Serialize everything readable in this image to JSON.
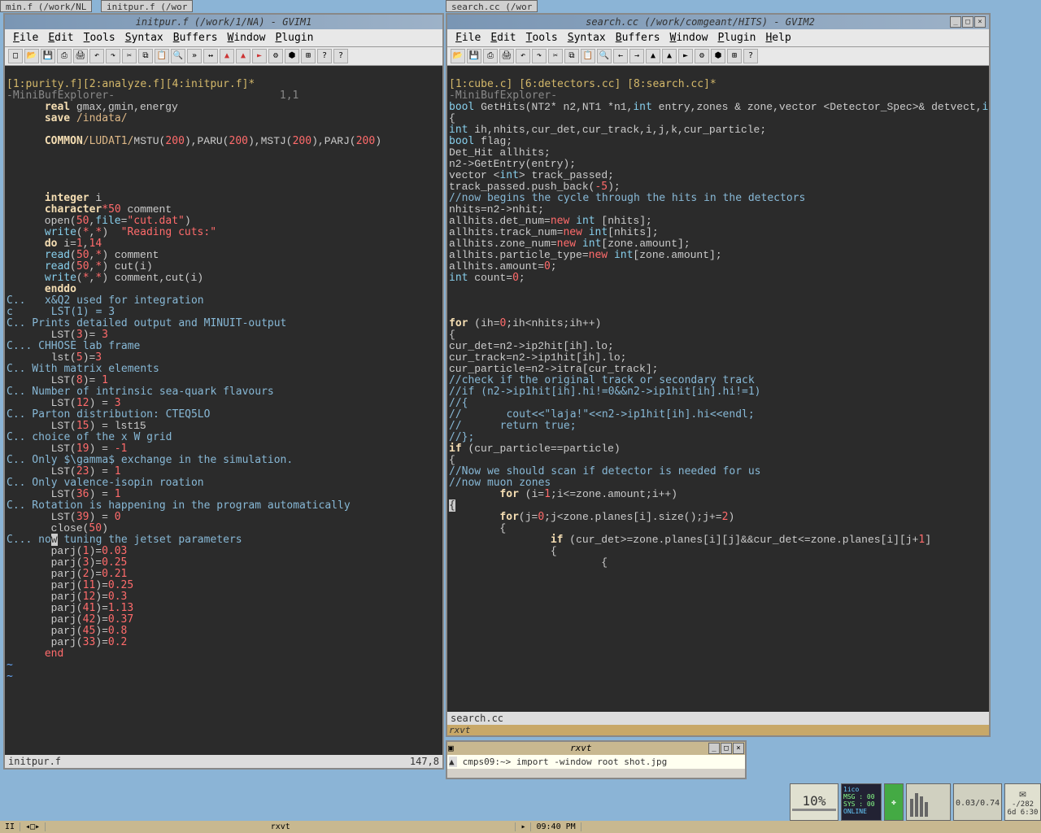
{
  "wmtabs": {
    "t1": "min.f  (/work/NL",
    "t2": "initpur.f  (/wor",
    "t3": "search.cc  (/wor"
  },
  "gvim1": {
    "title": "initpur.f (/work/1/NA) - GVIM1",
    "menus": [
      "File",
      "Edit",
      "Tools",
      "Syntax",
      "Buffers",
      "Window",
      "Plugin"
    ],
    "bufline": "[1:purity.f][2:analyze.f][4:initpur.f]*",
    "minibuf": "-MiniBufExplorer-",
    "mbpos": "1,1",
    "status_l": "initpur.f",
    "status_r": "147,8"
  },
  "gvim2": {
    "title": "search.cc (/work/comgeant/HITS) - GVIM2",
    "menus": [
      "File",
      "Edit",
      "Tools",
      "Syntax",
      "Buffers",
      "Window",
      "Plugin",
      "Help"
    ],
    "bufline": "[1:cube.c] [6:detectors.cc] [8:search.cc]*",
    "minibuf": "-MiniBufExplorer-",
    "status": "search.cc",
    "sbar": "rxvt"
  },
  "rxvt": {
    "title": "rxvt",
    "prompt": "cmps09:~> import -window root shot.jpg"
  },
  "panel": {
    "mode": "II",
    "task": "rxvt",
    "time": "09:40 PM"
  },
  "tray": {
    "cpu": "10%",
    "net1": "MSG : 00",
    "net2": "SYS : 00",
    "net3": "ONLINE",
    "load": "0.03/0.74",
    "mail": "-/282",
    "uptime": "6d  6:30",
    "speed": "1ico"
  }
}
